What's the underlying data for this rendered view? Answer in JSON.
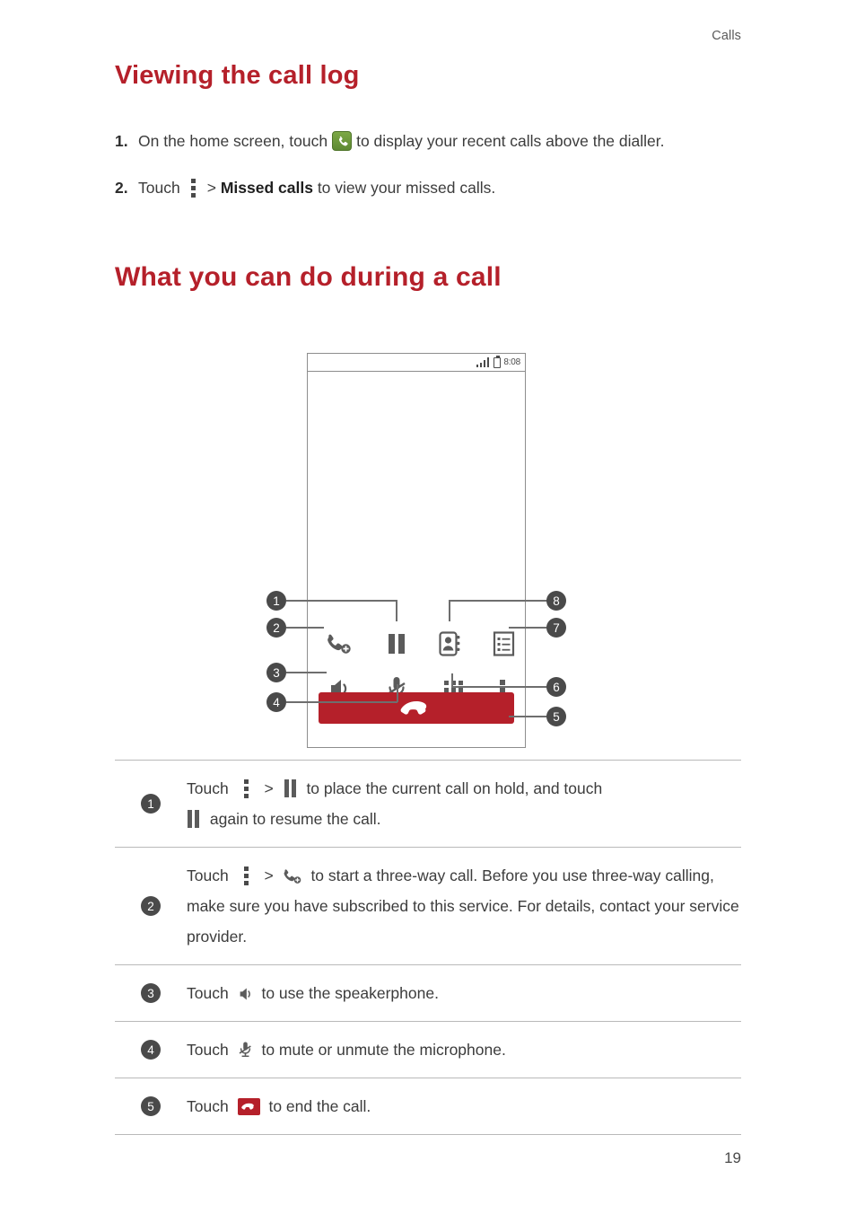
{
  "header": {
    "running_head": "Calls"
  },
  "headings": {
    "h1": "Viewing the call log",
    "h2": "What you can do during a call"
  },
  "steps": [
    {
      "number": "1.",
      "text_before": "On the home screen, touch",
      "icon": "green-dialer-icon",
      "text_after": "to display your recent calls above the dialler."
    },
    {
      "number": "2.",
      "text_before": "Touch",
      "icon": "kebab-menu-icon",
      "separator": ">",
      "bold_text": "Missed calls",
      "text_after": "to view your missed calls."
    }
  ],
  "phone_mockup": {
    "status_bar": {
      "signal_icon": "signal-bars-icon",
      "battery_icon": "battery-icon",
      "time": "8:08"
    },
    "controls": [
      {
        "callout": "1",
        "name": "pause-icon",
        "label": "Hold"
      },
      {
        "callout": "2",
        "name": "add-call-icon",
        "label": "Add call"
      },
      {
        "callout": "3",
        "name": "speaker-icon",
        "label": "Speakerphone"
      },
      {
        "callout": "4",
        "name": "mute-microphone-icon",
        "label": "Mute"
      },
      {
        "callout": "5",
        "name": "end-call-button",
        "label": "End call"
      },
      {
        "callout": "6",
        "name": "keypad-icon",
        "label": "Keypad"
      },
      {
        "callout": "7",
        "name": "notes-icon",
        "label": "Notes"
      },
      {
        "callout": "8",
        "name": "contacts-icon",
        "label": "Contacts"
      }
    ],
    "callout_numbers": [
      "1",
      "2",
      "3",
      "4",
      "5",
      "6",
      "7",
      "8"
    ]
  },
  "description_rows": [
    {
      "number": "1",
      "line1_a": "Touch",
      "line1_icon1": "kebab-menu-icon",
      "line1_sep": ">",
      "line1_icon2": "pause-icon",
      "line1_b": "to place the current call on hold, and touch",
      "line2_icon": "pause-icon",
      "line2_b": "again to resume the call."
    },
    {
      "number": "2",
      "line1_a": "Touch",
      "line1_icon1": "kebab-menu-icon",
      "line1_sep": ">",
      "line1_icon2": "add-call-icon",
      "line1_b": "to start a three-way call. Before you use three-way calling, make sure you have subscribed to this service. For details, contact your service provider."
    },
    {
      "number": "3",
      "line1_a": "Touch",
      "line1_icon2": "speaker-icon",
      "line1_b": "to use the speakerphone."
    },
    {
      "number": "4",
      "line1_a": "Touch",
      "line1_icon2": "mute-microphone-icon",
      "line1_b": "to mute or unmute the microphone."
    },
    {
      "number": "5",
      "line1_a": "Touch",
      "line1_icon2": "end-call-icon",
      "line1_b": "to end the call."
    }
  ],
  "footer": {
    "page_number": "19"
  },
  "colors": {
    "heading_red": "#b5202a",
    "callout_gray": "#4a4a4a",
    "dialer_green": "#6d9a3c",
    "body_text": "#3c3c3c"
  }
}
